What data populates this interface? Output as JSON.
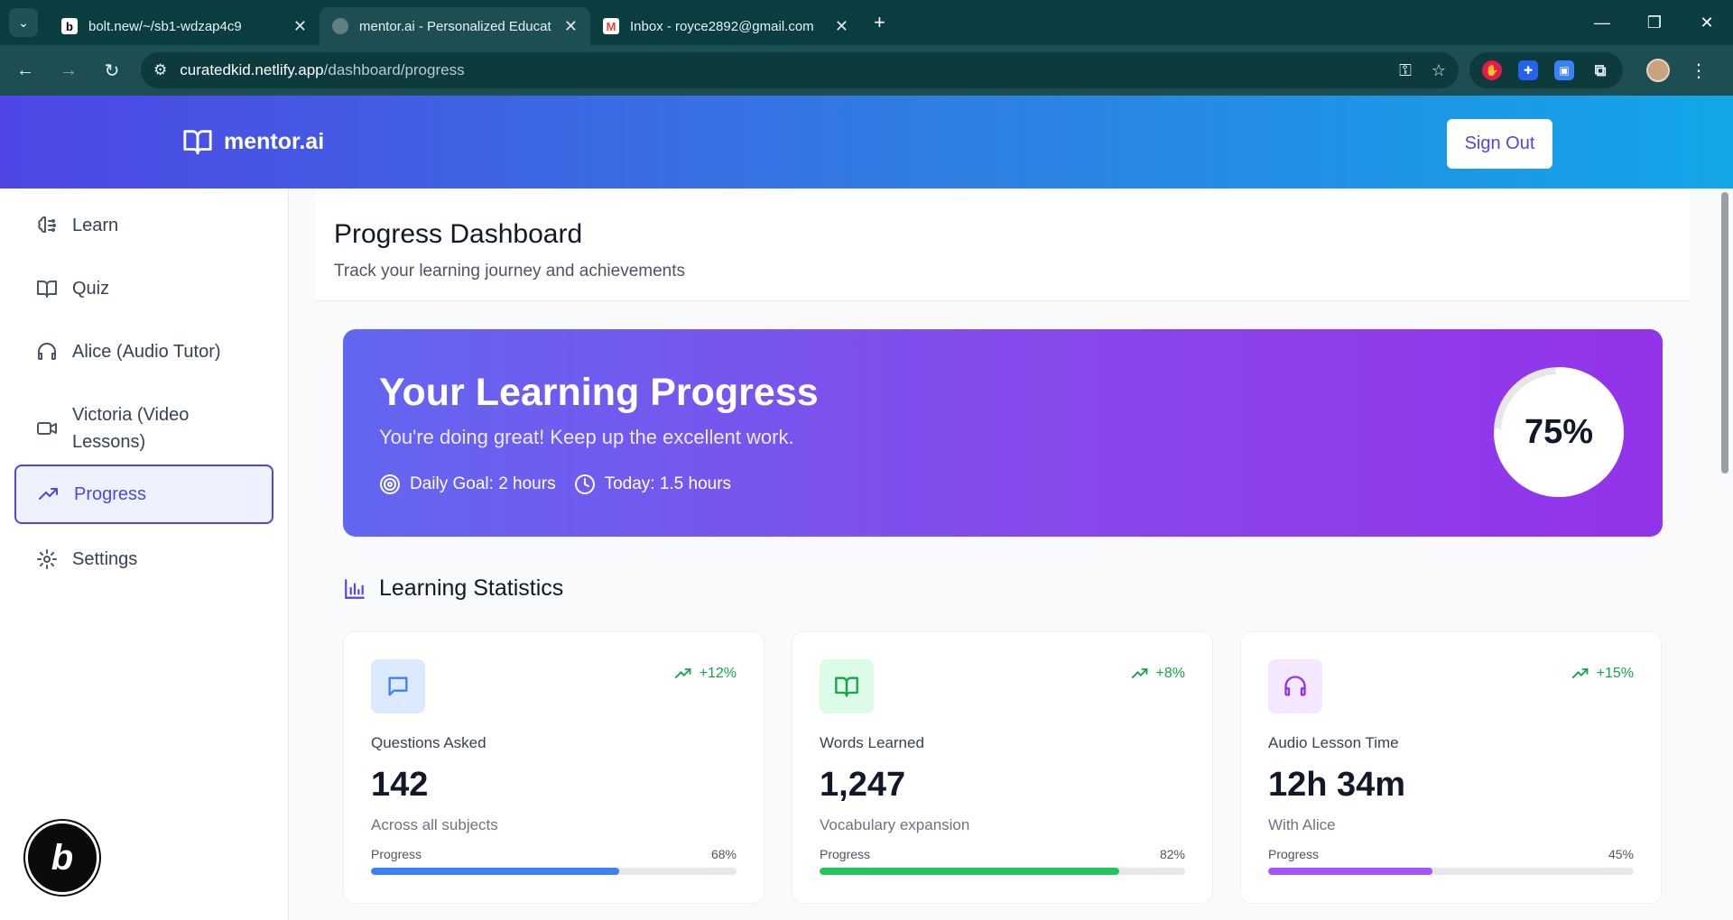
{
  "browser": {
    "tabs": [
      {
        "title": "bolt.new/~/sb1-wdzap4c9",
        "favicon": "bolt-icon"
      },
      {
        "title": "mentor.ai - Personalized Educat",
        "favicon": "globe-icon"
      },
      {
        "title": "Inbox - royce2892@gmail.com",
        "favicon": "gmail-icon"
      }
    ],
    "url_host": "curatedkid.netlify.app",
    "url_path": "/dashboard/progress"
  },
  "header": {
    "brand": "mentor.ai",
    "signout_label": "Sign Out"
  },
  "sidebar": {
    "items": [
      {
        "label": "Learn",
        "icon": "brain-icon"
      },
      {
        "label": "Quiz",
        "icon": "book-icon"
      },
      {
        "label": "Alice (Audio Tutor)",
        "icon": "headphones-icon"
      },
      {
        "label": "Victoria (Video Lessons)",
        "icon": "video-icon"
      },
      {
        "label": "Progress",
        "icon": "trending-up-icon",
        "active": true
      },
      {
        "label": "Settings",
        "icon": "gear-icon"
      }
    ]
  },
  "page": {
    "title": "Progress Dashboard",
    "subtitle": "Track your learning journey and achievements"
  },
  "hero": {
    "title": "Your Learning Progress",
    "subtitle": "You're doing great! Keep up the excellent work.",
    "daily_goal": "Daily Goal: 2 hours",
    "today": "Today: 1.5 hours",
    "percent_label": "75%",
    "percent": 0.75
  },
  "stats": {
    "heading": "Learning Statistics",
    "cards": [
      {
        "label": "Questions Asked",
        "value": "142",
        "desc": "Across all subjects",
        "trend": "+12%",
        "progress_label": "Progress",
        "progress_text": "68%",
        "progress": 0.68,
        "icon": "message-icon",
        "color": "#3b82f6",
        "icon_bg": "#dbeafe"
      },
      {
        "label": "Words Learned",
        "value": "1,247",
        "desc": "Vocabulary expansion",
        "trend": "+8%",
        "progress_label": "Progress",
        "progress_text": "82%",
        "progress": 0.82,
        "icon": "book-open-icon",
        "color": "#22c55e",
        "icon_bg": "#dcfce7"
      },
      {
        "label": "Audio Lesson Time",
        "value": "12h 34m",
        "desc": "With Alice",
        "trend": "+15%",
        "progress_label": "Progress",
        "progress_text": "45%",
        "progress": 0.45,
        "icon": "headphones-icon",
        "color": "#a855f7",
        "icon_bg": "#f3e8ff"
      }
    ]
  },
  "colors": {
    "accent": "#4f46e5",
    "trend": "#16a34a"
  }
}
